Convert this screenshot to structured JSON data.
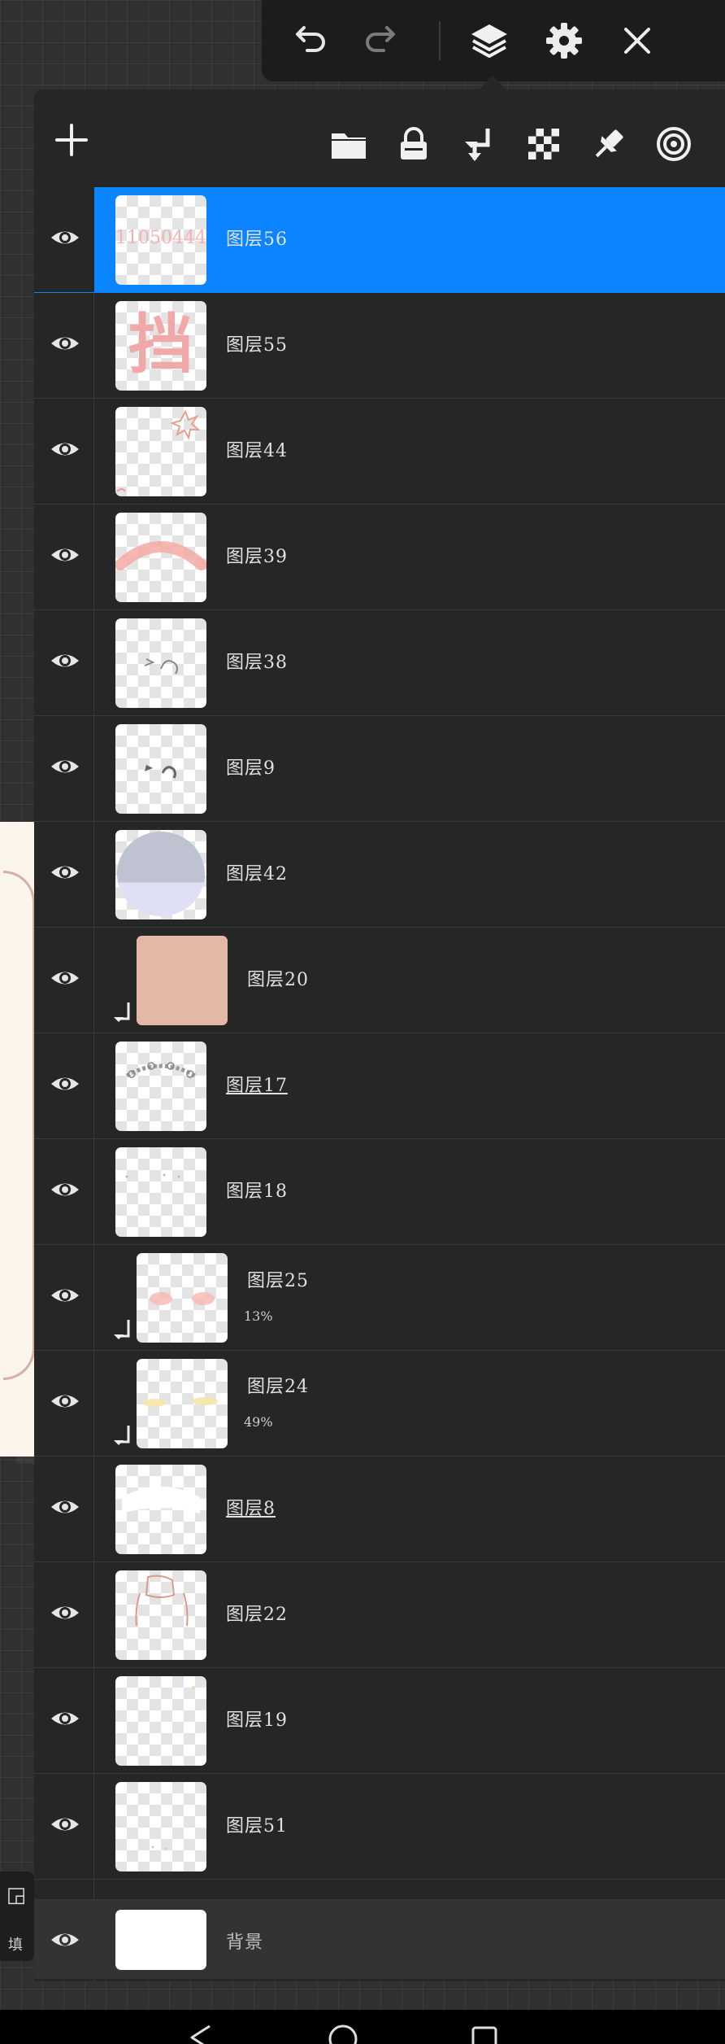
{
  "toolbar": {
    "icons": [
      "undo-icon",
      "redo-icon",
      "layers-icon",
      "settings-gear-icon",
      "close-icon"
    ]
  },
  "panel_header": {
    "icons": [
      "add-layer-icon",
      "folder-icon",
      "lock-icon",
      "merge-down-icon",
      "alpha-lock-icon",
      "pin-icon",
      "target-icon"
    ]
  },
  "layers": [
    {
      "name": "图层56",
      "thumb_text": "11050444",
      "selected": true
    },
    {
      "name": "图层55",
      "thumb_text": "挡"
    },
    {
      "name": "图层44"
    },
    {
      "name": "图层39"
    },
    {
      "name": "图层38"
    },
    {
      "name": "图层9"
    },
    {
      "name": "图层42"
    },
    {
      "name": "图层20",
      "clipped": true
    },
    {
      "name": "图层17",
      "underlined": true
    },
    {
      "name": "图层18"
    },
    {
      "name": "图层25",
      "clipped": true,
      "opacity": "13%"
    },
    {
      "name": "图层24",
      "clipped": true,
      "opacity": "49%"
    },
    {
      "name": "图层8",
      "underlined": true
    },
    {
      "name": "图层22"
    },
    {
      "name": "图层19"
    },
    {
      "name": "图层51"
    }
  ],
  "background_layer": {
    "name": "背景"
  },
  "side_tool": {
    "label": "填"
  },
  "colors": {
    "selected": "#0a84ff",
    "panel": "#262626",
    "toolbar": "#1c1c1c"
  }
}
